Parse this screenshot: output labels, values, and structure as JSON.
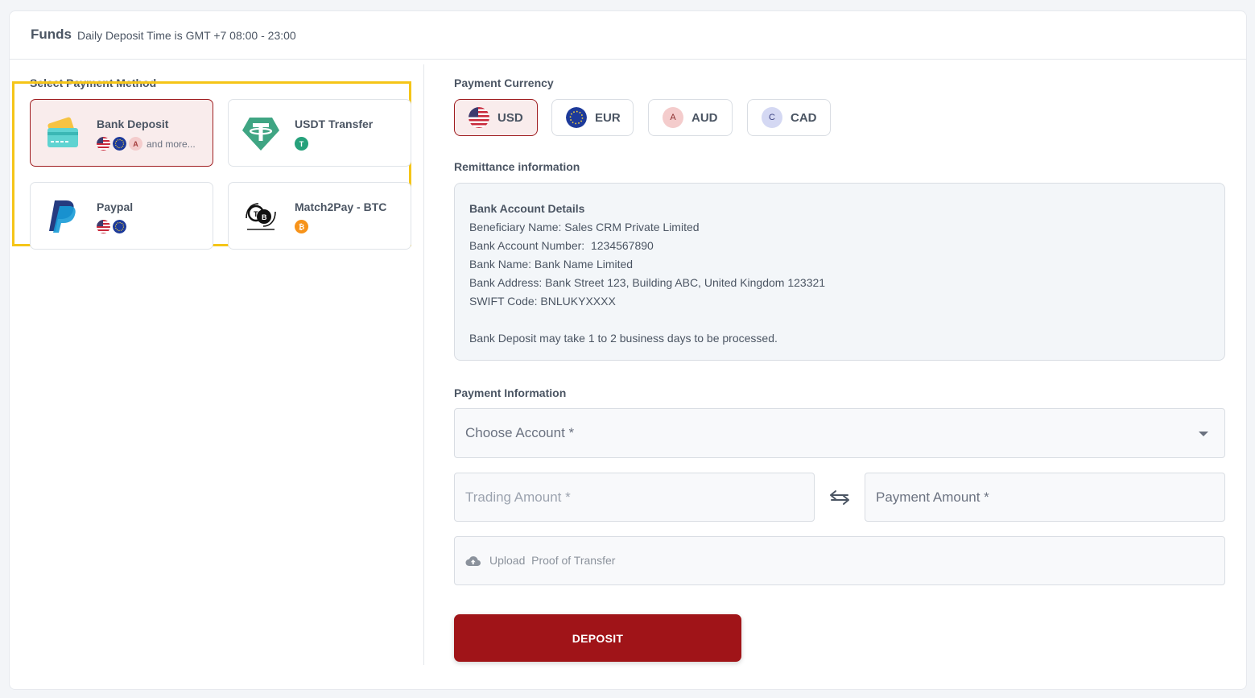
{
  "header": {
    "title": "Funds",
    "subtitle": "Daily Deposit Time is GMT +7 08:00 - 23:00"
  },
  "payment_methods": {
    "label": "Select Payment Method",
    "items": [
      {
        "name": "Bank Deposit",
        "selected": true,
        "currencies": [
          "USD",
          "EUR",
          "AUD"
        ],
        "more": "and more..."
      },
      {
        "name": "USDT Transfer",
        "selected": false,
        "currencies": [
          "USDT"
        ]
      },
      {
        "name": "Paypal",
        "selected": false,
        "currencies": [
          "USD",
          "EUR"
        ]
      },
      {
        "name": "Match2Pay - BTC",
        "selected": false,
        "currencies": [
          "BTC"
        ]
      }
    ]
  },
  "payment_currency": {
    "label": "Payment Currency",
    "options": [
      {
        "code": "USD",
        "selected": true
      },
      {
        "code": "EUR",
        "selected": false
      },
      {
        "code": "AUD",
        "badge": "A",
        "selected": false
      },
      {
        "code": "CAD",
        "badge": "C",
        "selected": false
      }
    ]
  },
  "remittance": {
    "label": "Remittance information",
    "title": "Bank Account Details",
    "beneficiary": "Beneficiary Name: Sales CRM Private Limited",
    "account_number": "Bank Account Number:  1234567890",
    "bank_name": "Bank Name: Bank Name Limited",
    "bank_address": "Bank Address: Bank Street 123, Building ABC, United Kingdom 123321",
    "swift": "SWIFT Code: BNLUKYXXXX",
    "note": "Bank Deposit may take 1 to 2 business days to be processed."
  },
  "payment_info": {
    "label": "Payment Information",
    "choose_account": "Choose Account *",
    "trading_amount": "Trading Amount *",
    "payment_amount": "Payment Amount *",
    "upload": "Upload  Proof of Transfer"
  },
  "actions": {
    "deposit": "DEPOSIT"
  },
  "colors": {
    "brand": "#a01418",
    "selected_bg": "#f9ecec",
    "highlight": "#f5c518",
    "usdt": "#26a17b",
    "btc": "#f7931a"
  }
}
